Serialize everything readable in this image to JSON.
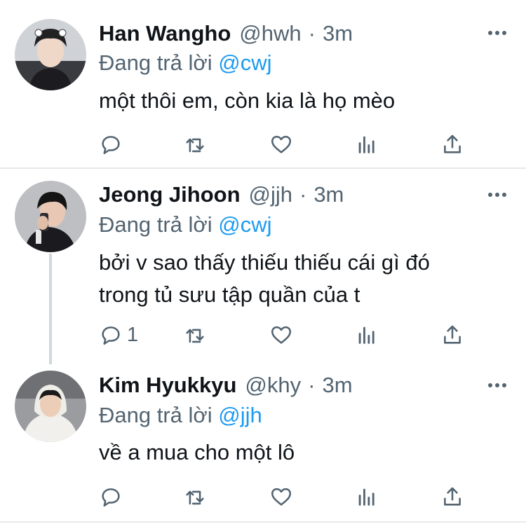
{
  "tweets": [
    {
      "name": "Han Wangho",
      "handle": "@hwh",
      "time": "3m",
      "reply_prefix": "Đang trả lời",
      "reply_to": "@cwj",
      "lines": [
        "một thôi em, còn kia là họ mèo"
      ],
      "reply_count": "",
      "avatar_icon": "user-avatar-photo"
    },
    {
      "name": "Jeong Jihoon",
      "handle": "@jjh",
      "time": "3m",
      "reply_prefix": "Đang trả lời",
      "reply_to": "@cwj",
      "lines": [
        "bởi v sao thấy thiếu thiếu cái gì đó",
        "trong tủ sưu tập quần của t"
      ],
      "reply_count": "1",
      "avatar_icon": "user-avatar-photo"
    },
    {
      "name": "Kim Hyukkyu",
      "handle": "@khy",
      "time": "3m",
      "reply_prefix": "Đang trả lời",
      "reply_to": "@jjh",
      "lines": [
        "về a mua cho một lô"
      ],
      "reply_count": "",
      "avatar_icon": "user-avatar-photo"
    }
  ],
  "separator": "·",
  "icons": [
    "more-icon",
    "reply-icon",
    "retweet-icon",
    "like-icon",
    "analytics-icon",
    "share-icon"
  ],
  "colors": {
    "text": "#0f1419",
    "secondary": "#536471",
    "link": "#1d9bf0",
    "divider": "#e7e9ea"
  }
}
